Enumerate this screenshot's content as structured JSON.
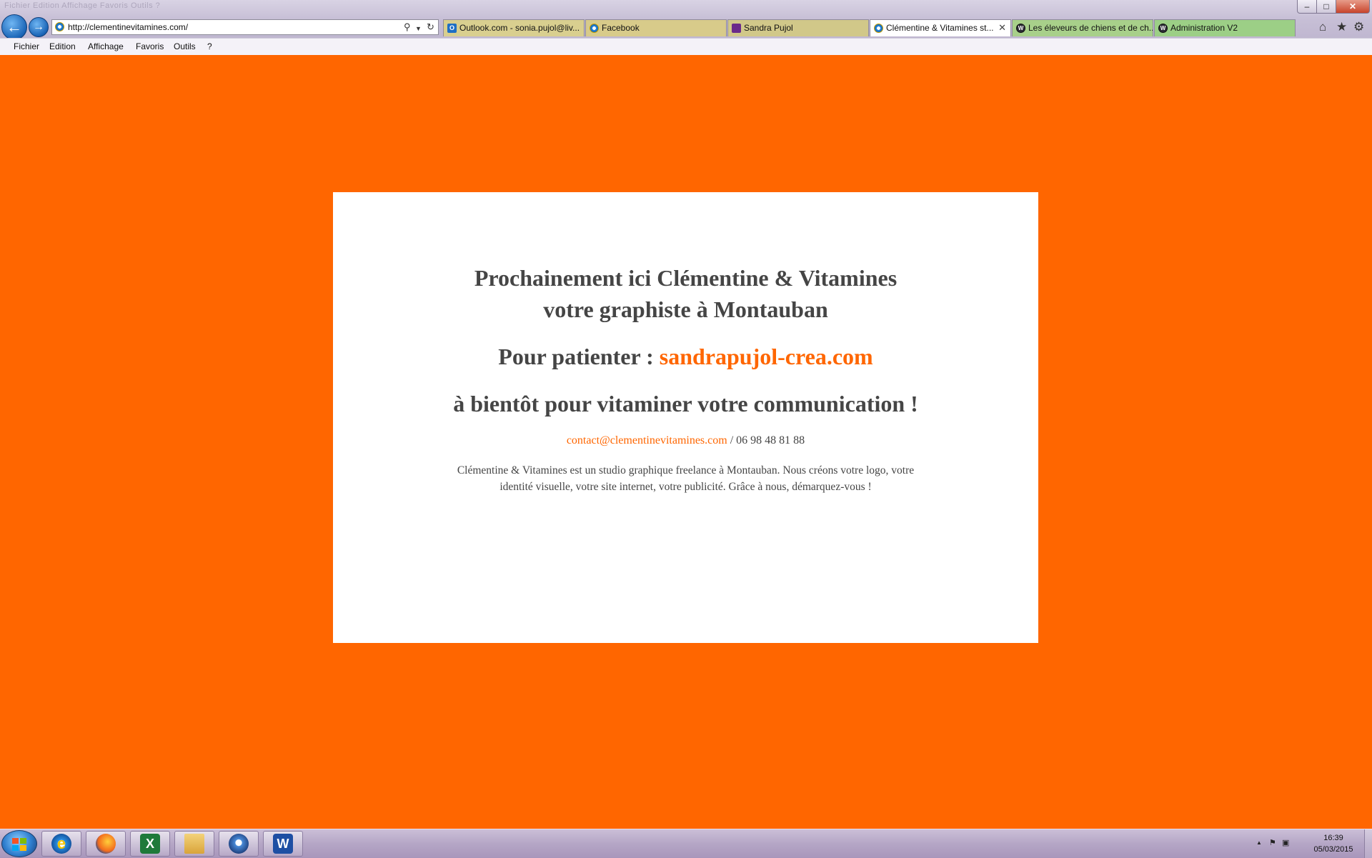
{
  "browser": {
    "ghost_menu": "Fichier   Edition   Affichage   Favoris   Outils   ?",
    "address": "http://clementinevitamines.com/",
    "tabs": [
      {
        "label": "Outlook.com - sonia.pujol@liv...",
        "icon": "outlook-icon"
      },
      {
        "label": "Facebook",
        "icon": "ie-page-icon"
      },
      {
        "label": "Sandra Pujol",
        "icon": "site-icon"
      },
      {
        "label": "Clémentine & Vitamines st...",
        "icon": "ie-page-icon",
        "active": true
      },
      {
        "label": "Les éleveurs de chiens et de ch...",
        "icon": "wordpress-icon"
      },
      {
        "label": "Administration V2",
        "icon": "wordpress-icon"
      }
    ],
    "tab_colors": [
      "#d9cf8f",
      "#d8cb8a",
      "#d1c889",
      "#ffffff",
      "#a8d08a",
      "#9ccf86"
    ],
    "menu": [
      "Fichier",
      "Edition",
      "Affichage",
      "Favoris",
      "Outils",
      "?"
    ],
    "window_controls": {
      "minimize": "–",
      "maximize": "□",
      "close": "✕"
    }
  },
  "page": {
    "background_color": "#ff6600",
    "accent_color": "#ff6600",
    "text_color": "#454545",
    "heading_line1": "Prochainement ici Clémentine & Vitamines",
    "heading_line2": "votre graphiste à Montauban",
    "patienter_label": "Pour patienter : ",
    "patienter_link": "sandrapujol-crea.com",
    "bientot": "à bientôt pour vitaminer votre communication !",
    "contact_email": "contact@clementinevitamines.com",
    "contact_separator": " / ",
    "contact_phone": "06 98 48 81 88",
    "description": "Clémentine & Vitamines est un studio graphique freelance à Montauban. Nous créons votre logo, votre identité visuelle, votre site internet, votre publicité. Grâce à nous, démarquez-vous !"
  },
  "taskbar": {
    "apps": [
      "internet-explorer",
      "firefox",
      "excel",
      "windows-explorer",
      "thunderbird",
      "word"
    ],
    "clock_time": "16:39",
    "clock_date": "05/03/2015"
  }
}
